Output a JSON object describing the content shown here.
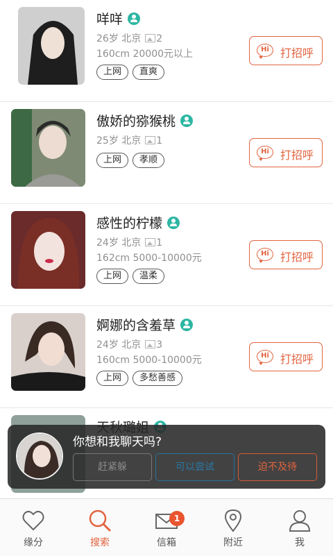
{
  "profiles": [
    {
      "name": "咩咩",
      "age": "26岁",
      "city": "北京",
      "photos": "2",
      "height_income": "160cm 20000元以上",
      "tags": [
        "上网",
        "直爽"
      ],
      "action": "打招呼",
      "hi": "Hi"
    },
    {
      "name": "傲娇的猕猴桃",
      "age": "25岁",
      "city": "北京",
      "photos": "1",
      "height_income": "",
      "tags": [
        "上网",
        "孝顺"
      ],
      "action": "打招呼",
      "hi": "Hi"
    },
    {
      "name": "感性的柠檬",
      "age": "24岁",
      "city": "北京",
      "photos": "1",
      "height_income": "162cm 5000-10000元",
      "tags": [
        "上网",
        "温柔"
      ],
      "action": "打招呼",
      "hi": "Hi"
    },
    {
      "name": "婀娜的含羞草",
      "age": "24岁",
      "city": "北京",
      "photos": "3",
      "height_income": "160cm 5000-10000元",
      "tags": [
        "上网",
        "多愁善感"
      ],
      "action": "打招呼",
      "hi": "Hi"
    },
    {
      "name": "天秋璐姐",
      "age": "",
      "city": "",
      "photos": "",
      "height_income": "",
      "tags": [],
      "action": "",
      "hi": ""
    }
  ],
  "popup": {
    "title": "你想和我聊天吗?",
    "buttons": [
      "赶紧躲",
      "可以尝试",
      "迫不及待"
    ]
  },
  "tabbar": {
    "tabs": [
      {
        "label": "缘分",
        "icon": "heart-icon",
        "active": false
      },
      {
        "label": "搜索",
        "icon": "search-icon",
        "active": true
      },
      {
        "label": "信箱",
        "icon": "mail-icon",
        "active": false,
        "badge": "1"
      },
      {
        "label": "附近",
        "icon": "location-icon",
        "active": false
      },
      {
        "label": "我",
        "icon": "user-icon",
        "active": false
      }
    ]
  },
  "colors": {
    "accent": "#e2633f",
    "verified": "#2db6a3",
    "badge": "#e9552f"
  }
}
